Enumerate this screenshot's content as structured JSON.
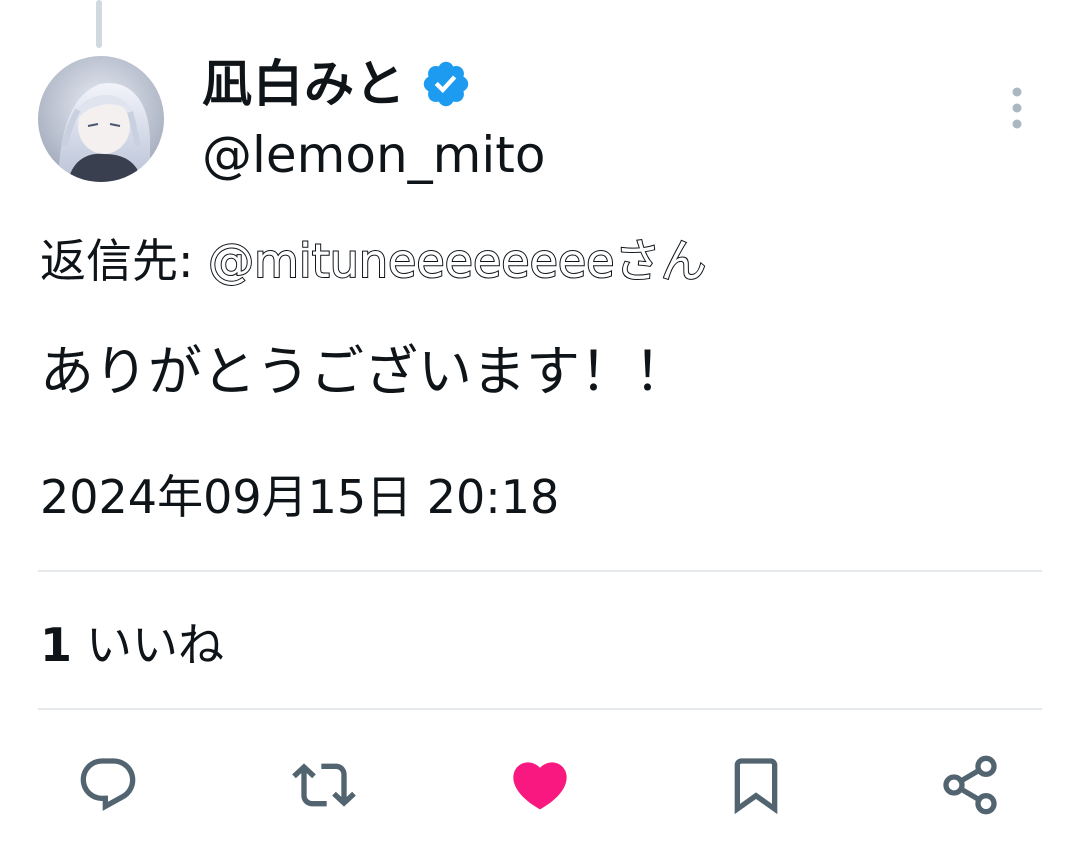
{
  "author": {
    "display_name": "凪白みと",
    "handle": "@lemon_mito",
    "verified": true
  },
  "reply": {
    "prefix": "返信先: ",
    "mention": "@mituneeeeeeee",
    "suffix": "さん"
  },
  "tweet": {
    "text": "ありがとうございます！！",
    "timestamp": "2024年09月15日 20:18"
  },
  "stats": {
    "likes_count": "1",
    "likes_label": "いいね"
  },
  "actions": {
    "icons": [
      "reply-icon",
      "retweet-icon",
      "like-icon",
      "bookmark-icon",
      "share-icon"
    ]
  },
  "colors": {
    "verified": "#1d9bf0",
    "like_active": "#f91880",
    "icon_gray": "#536471",
    "divider": "#e6e9eb",
    "thread_line": "#cfd9de"
  }
}
